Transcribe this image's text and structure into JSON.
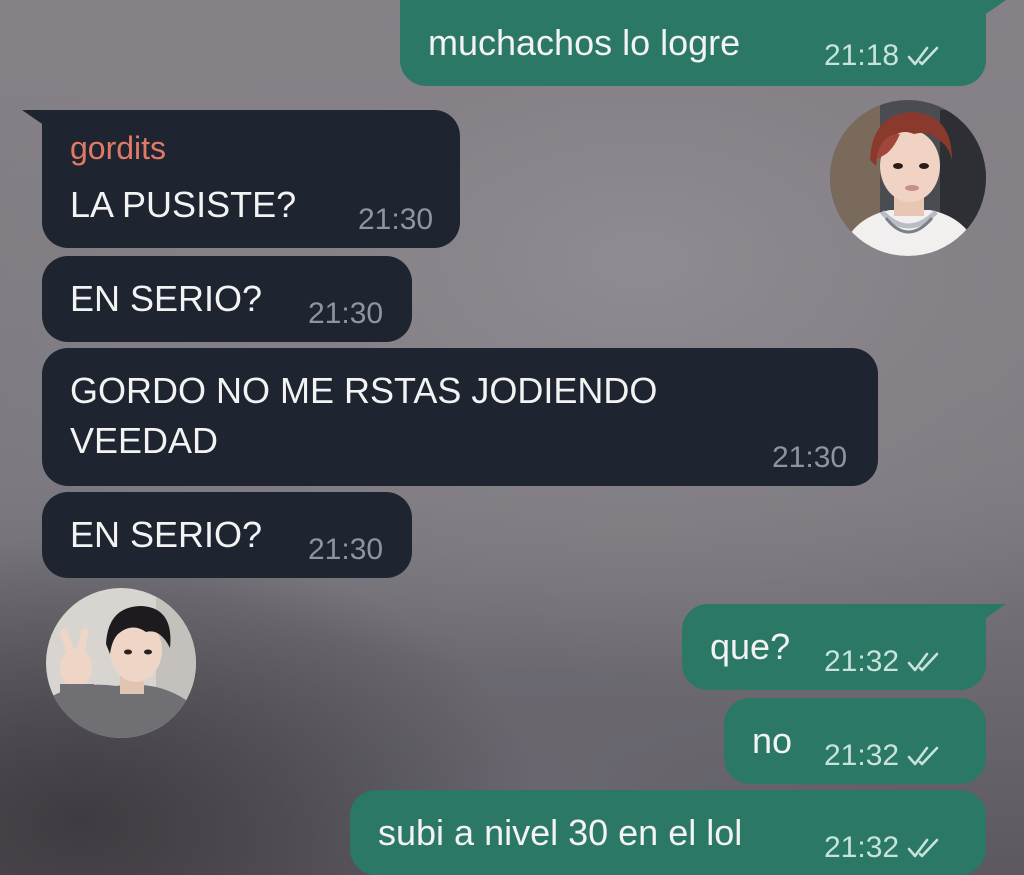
{
  "messages": {
    "m1": {
      "text": "muchachos lo logre",
      "time": "21:18",
      "read_icon": "double-check-icon"
    },
    "m2": {
      "sender": "gordits",
      "text": "LA PUSISTE?",
      "time": "21:30"
    },
    "m3": {
      "text": "EN SERIO?",
      "time": "21:30"
    },
    "m4": {
      "line1": "GORDO NO ME RSTAS JODIENDO",
      "line2": "VEEDAD",
      "time": "21:30"
    },
    "m5": {
      "text": "EN SERIO?",
      "time": "21:30"
    },
    "m6": {
      "text": "que?",
      "time": "21:32",
      "read_icon": "double-check-icon"
    },
    "m7": {
      "text": "no",
      "time": "21:32",
      "read_icon": "double-check-icon"
    },
    "m8": {
      "text": "subi a nivel 30 en el lol",
      "time": "21:32",
      "read_icon": "double-check-icon"
    }
  },
  "avatars": {
    "top_right": "avatar-red-hair-photo",
    "bottom_left": "avatar-peace-sign-photo"
  },
  "colors": {
    "incoming_bubble": "#1f2530",
    "outgoing_bubble": "#2b7866",
    "sender_name": "#e07a66",
    "incoming_time": "#8d95a0",
    "outgoing_time": "#c7e3da"
  }
}
